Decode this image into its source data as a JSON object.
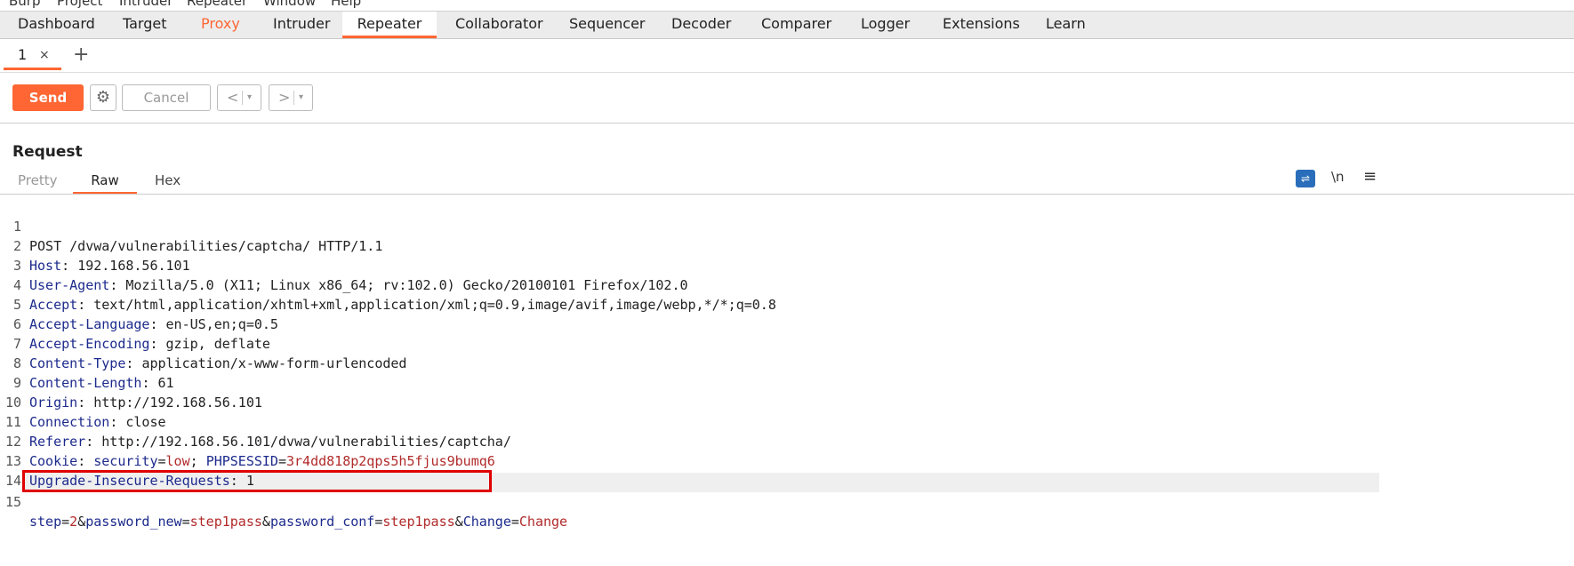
{
  "menubar": [
    "Burp",
    "Project",
    "Intruder",
    "Repeater",
    "Window",
    "Help"
  ],
  "main_tabs": [
    "Dashboard",
    "Target",
    "Proxy",
    "Intruder",
    "Repeater",
    "Collaborator",
    "Sequencer",
    "Decoder",
    "Comparer",
    "Logger",
    "Extensions",
    "Learn"
  ],
  "active_main_tab": "Repeater",
  "repeater_tabs": [
    {
      "label": "1",
      "close": "×"
    }
  ],
  "add_tab": "+",
  "actions": {
    "send": "Send",
    "settings_icon": "gear-icon",
    "cancel": "Cancel",
    "back": "<",
    "forward": ">",
    "dropdown": "▾"
  },
  "request": {
    "title": "Request",
    "view_tabs": [
      "Pretty",
      "Raw",
      "Hex"
    ],
    "active_view": "Raw",
    "icons": {
      "wrap": "wrap-icon",
      "newline": "\\n",
      "menu": "≡"
    },
    "lines": [
      {
        "n": "1",
        "text": "POST /dvwa/vulnerabilities/captcha/ HTTP/1.1"
      },
      {
        "n": "2",
        "key": "Host",
        "value": "192.168.56.101"
      },
      {
        "n": "3",
        "key": "User-Agent",
        "value": "Mozilla/5.0 (X11; Linux x86_64; rv:102.0) Gecko/20100101 Firefox/102.0"
      },
      {
        "n": "4",
        "key": "Accept",
        "value": "text/html,application/xhtml+xml,application/xml;q=0.9,image/avif,image/webp,*/*;q=0.8"
      },
      {
        "n": "5",
        "key": "Accept-Language",
        "value": "en-US,en;q=0.5"
      },
      {
        "n": "6",
        "key": "Accept-Encoding",
        "value": "gzip, deflate"
      },
      {
        "n": "7",
        "key": "Content-Type",
        "value": "application/x-www-form-urlencoded"
      },
      {
        "n": "8",
        "key": "Content-Length",
        "value": "61"
      },
      {
        "n": "9",
        "key": "Origin",
        "value": "http://192.168.56.101"
      },
      {
        "n": "10",
        "key": "Connection",
        "value": "close"
      },
      {
        "n": "11",
        "key": "Referer",
        "value": "http://192.168.56.101/dvwa/vulnerabilities/captcha/"
      },
      {
        "n": "12",
        "key": "Cookie"
      },
      {
        "n": "13",
        "key": "Upgrade-Insecure-Requests",
        "value": "1"
      },
      {
        "n": "14"
      },
      {
        "n": "15"
      }
    ],
    "cookie": {
      "k1": "security",
      "v1": "low",
      "k2": "PHPSESSID",
      "v2": "3r4dd818p2qps5h5fjus9bumq6"
    },
    "body": {
      "k1": "step",
      "v1": "2",
      "k2": "password_new",
      "v2": "step1pass",
      "k3": "password_conf",
      "v3": "step1pass",
      "k4": "Change",
      "v4": "Change"
    }
  }
}
